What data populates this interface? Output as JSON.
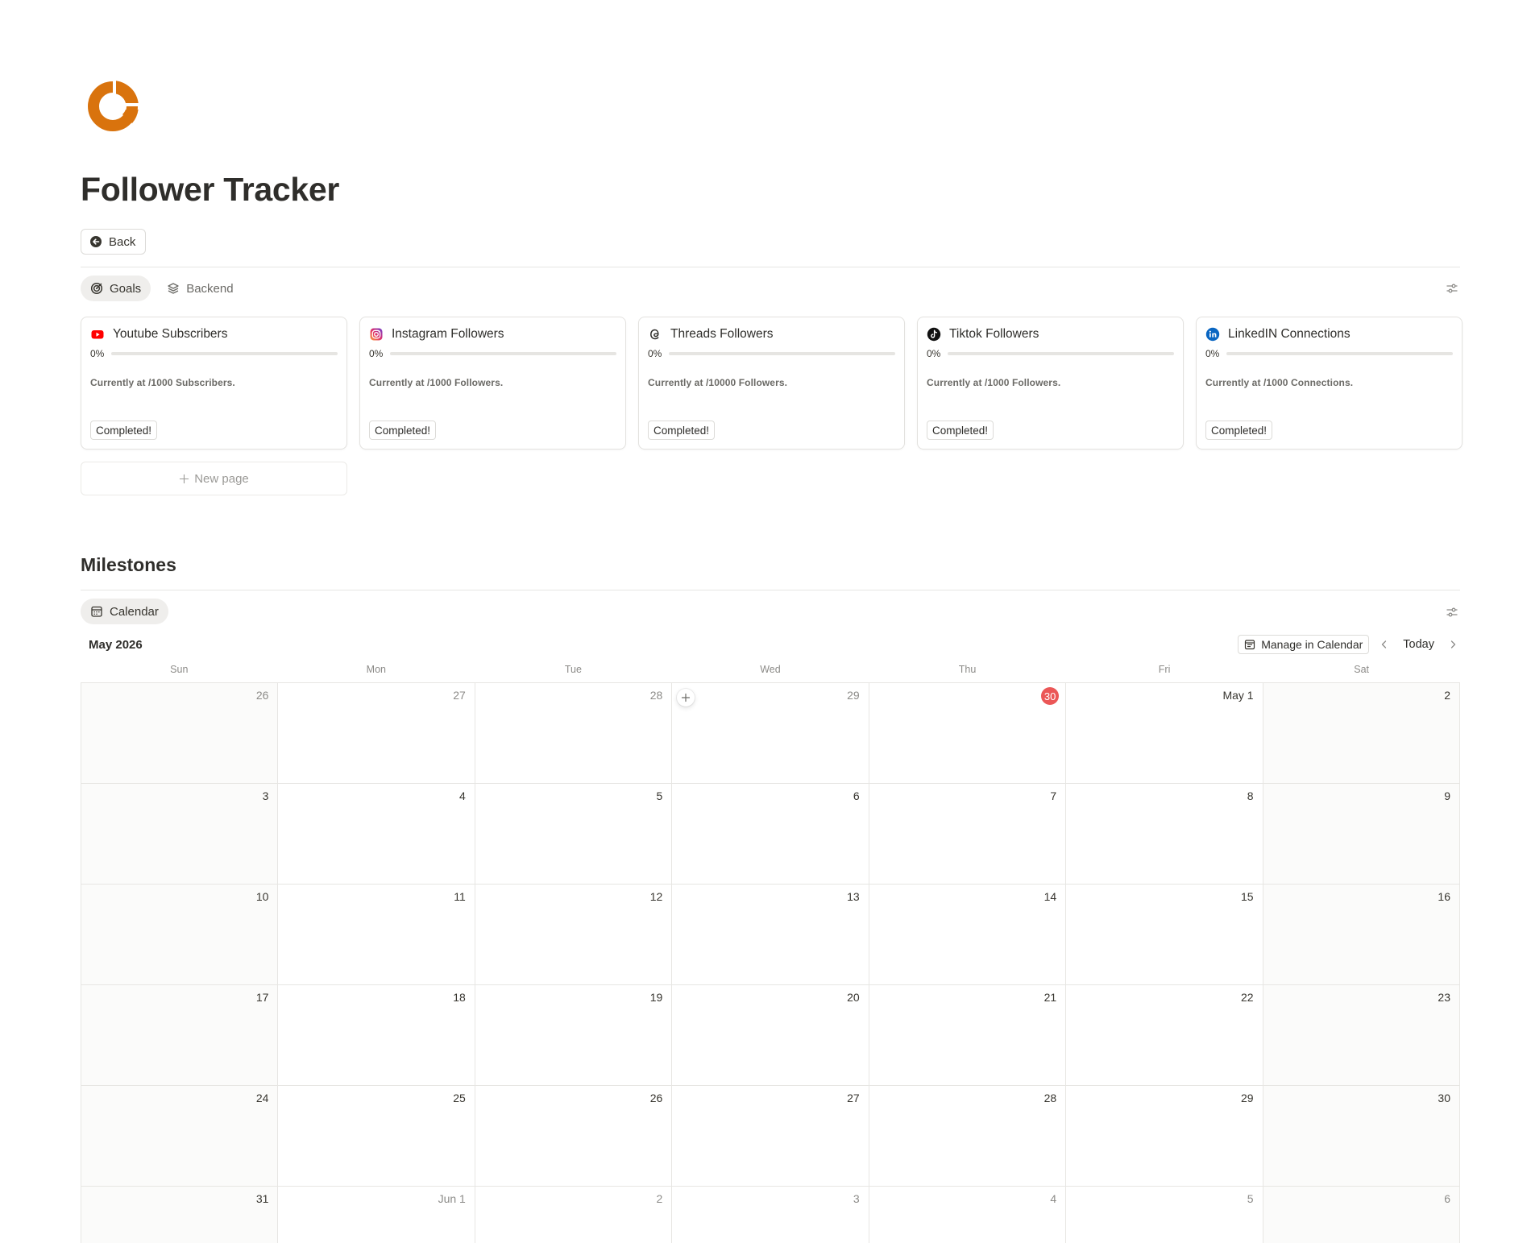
{
  "page": {
    "title": "Follower Tracker",
    "back_label": "Back"
  },
  "goals_view": {
    "tabs": [
      {
        "label": "Goals",
        "icon": "target-icon"
      },
      {
        "label": "Backend",
        "icon": "stack-icon"
      }
    ],
    "cards": [
      {
        "name": "Youtube Subscribers",
        "icon": "youtube-icon",
        "progress_label": "0%",
        "progress": 0,
        "description": "Currently at /1000 Subscribers.",
        "status": "Completed!"
      },
      {
        "name": "Instagram Followers",
        "icon": "instagram-icon",
        "progress_label": "0%",
        "progress": 0,
        "description": "Currently at /1000 Followers.",
        "status": "Completed!"
      },
      {
        "name": "Threads Followers",
        "icon": "threads-icon",
        "progress_label": "0%",
        "progress": 0,
        "description": "Currently at /10000 Followers.",
        "status": "Completed!"
      },
      {
        "name": "Tiktok Followers",
        "icon": "tiktok-icon",
        "progress_label": "0%",
        "progress": 0,
        "description": "Currently at /1000 Followers.",
        "status": "Completed!"
      },
      {
        "name": "LinkedIN Connections",
        "icon": "linkedin-icon",
        "progress_label": "0%",
        "progress": 0,
        "description": "Currently at /1000 Connections.",
        "status": "Completed!"
      }
    ],
    "new_page_label": "New page"
  },
  "milestones": {
    "title": "Milestones",
    "tab_label": "Calendar",
    "month_label": "May 2026",
    "manage_label": "Manage in Calendar",
    "today_label": "Today",
    "weekdays": [
      "Sun",
      "Mon",
      "Tue",
      "Wed",
      "Thu",
      "Fri",
      "Sat"
    ],
    "weeks": [
      [
        {
          "label": "26",
          "other": true
        },
        {
          "label": "27",
          "other": true
        },
        {
          "label": "28",
          "other": true
        },
        {
          "label": "29",
          "other": true
        },
        {
          "label": "30",
          "other": true,
          "today": true
        },
        {
          "label": "May 1"
        },
        {
          "label": "2"
        }
      ],
      [
        {
          "label": "3"
        },
        {
          "label": "4"
        },
        {
          "label": "5"
        },
        {
          "label": "6"
        },
        {
          "label": "7"
        },
        {
          "label": "8"
        },
        {
          "label": "9"
        }
      ],
      [
        {
          "label": "10"
        },
        {
          "label": "11"
        },
        {
          "label": "12"
        },
        {
          "label": "13"
        },
        {
          "label": "14"
        },
        {
          "label": "15"
        },
        {
          "label": "16"
        }
      ],
      [
        {
          "label": "17"
        },
        {
          "label": "18"
        },
        {
          "label": "19"
        },
        {
          "label": "20"
        },
        {
          "label": "21"
        },
        {
          "label": "22"
        },
        {
          "label": "23"
        }
      ],
      [
        {
          "label": "24"
        },
        {
          "label": "25"
        },
        {
          "label": "26"
        },
        {
          "label": "27"
        },
        {
          "label": "28"
        },
        {
          "label": "29"
        },
        {
          "label": "30"
        }
      ],
      [
        {
          "label": "31"
        },
        {
          "label": "Jun 1",
          "other": true
        },
        {
          "label": "2",
          "other": true
        },
        {
          "label": "3",
          "other": true
        },
        {
          "label": "4",
          "other": true
        },
        {
          "label": "5",
          "other": true
        },
        {
          "label": "6",
          "other": true
        }
      ]
    ]
  },
  "colors": {
    "accent": "#d9730d",
    "today": "#eb5757",
    "youtube": "#ff0000",
    "linkedin": "#0a66c2"
  }
}
